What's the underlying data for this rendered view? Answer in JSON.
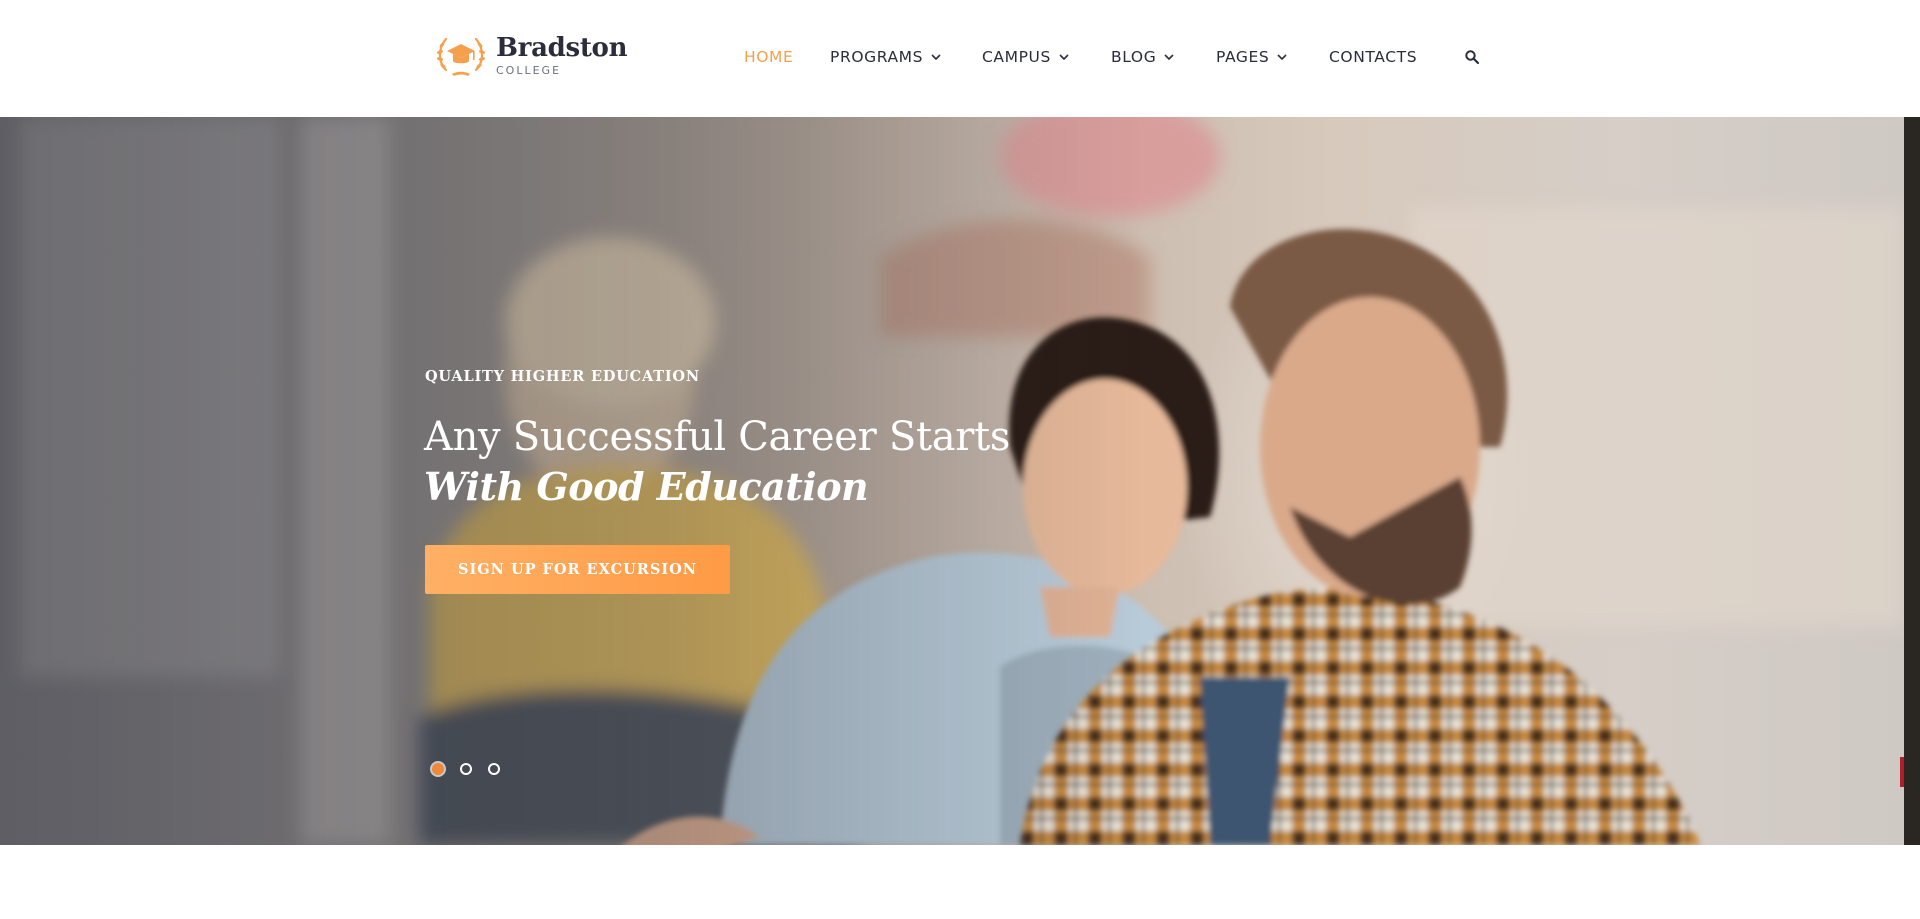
{
  "brand": {
    "name": "Bradston",
    "subtitle": "COLLEGE",
    "logo_icon": "graduation-cap-laurel-icon",
    "accent_color": "#f5a04d"
  },
  "nav": {
    "items": [
      {
        "label": "HOME",
        "active": true,
        "dropdown": false
      },
      {
        "label": "PROGRAMS",
        "active": false,
        "dropdown": true
      },
      {
        "label": "CAMPUS",
        "active": false,
        "dropdown": true
      },
      {
        "label": "BLOG",
        "active": false,
        "dropdown": true
      },
      {
        "label": "PAGES",
        "active": false,
        "dropdown": true
      },
      {
        "label": "CONTACTS",
        "active": false,
        "dropdown": false
      }
    ],
    "search_icon": "search-icon"
  },
  "hero": {
    "eyebrow": "QUALITY HIGHER EDUCATION",
    "headline_line1": "Any Successful Career Starts",
    "headline_line2": "With Good Education",
    "cta_label": "SIGN UP FOR EXCURSION",
    "cta_color": "#ff9f4a",
    "slider": {
      "slide_count": 3,
      "active_index": 0
    }
  }
}
